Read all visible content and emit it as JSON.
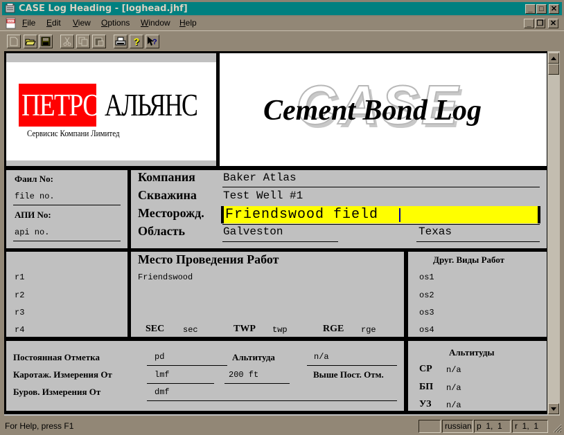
{
  "window": {
    "title": "CASE Log Heading - [loghead.jhf]",
    "controls": {
      "minimize": "_",
      "maximize": "□",
      "close": "✕",
      "restore": "❐"
    }
  },
  "menu": {
    "items": [
      {
        "label": "File",
        "accel": "F"
      },
      {
        "label": "Edit",
        "accel": "E"
      },
      {
        "label": "View",
        "accel": "V"
      },
      {
        "label": "Options",
        "accel": "O"
      },
      {
        "label": "Window",
        "accel": "W"
      },
      {
        "label": "Help",
        "accel": "H"
      }
    ]
  },
  "toolbar": {
    "buttons": [
      "new-file-icon",
      "open-folder-icon",
      "save-icon",
      "cut-icon",
      "copy-icon",
      "paste-icon",
      "print-icon",
      "help-icon",
      "context-help-icon"
    ]
  },
  "header": {
    "logo": {
      "red_part": "ПЕТРО",
      "black_part": "АЛЬЯНС",
      "subtitle": "Сервисис Компани Лимитед"
    },
    "watermark": "CASE",
    "log_title": "Cement Bond Log"
  },
  "well_info": {
    "file_no_label": "Фаил No:",
    "file_no_value": "file no.",
    "api_no_label": "АПИ No:",
    "api_no_value": "api no.",
    "company_label": "Компания",
    "company_value": "Baker Atlas",
    "well_label": "Скважина",
    "well_value": "Test Well #1",
    "field_label": "Месторожд.",
    "field_value": "Friendswood field",
    "field_highlight": "#ffff00",
    "region_label": "Область",
    "county_value": "Galveston",
    "state_value": "Texas"
  },
  "location": {
    "remarks": [
      "r1",
      "r2",
      "r3",
      "r4"
    ],
    "title": "Место Проведения Работ",
    "location_value": "Friendswood",
    "sec_label": "SEC",
    "sec_value": "sec",
    "twp_label": "TWP",
    "twp_value": "twp",
    "rge_label": "RGE",
    "rge_value": "rge",
    "other_services_title": "Друг. Виды Работ",
    "other_services": [
      "os1",
      "os2",
      "os3",
      "os4"
    ]
  },
  "datum": {
    "permanent_datum_label": "Постоянная Отметка",
    "permanent_datum_value": "pd",
    "elevation_label": "Альтитуда",
    "elevation_value": "n/a",
    "log_measured_label": "Каротаж. Измерения От",
    "log_measured_value": "lmf",
    "log_measured_offset": "200 ft",
    "above_pd_label": "Выше Пост. Отм.",
    "drill_measured_label": "Буров. Измерения От",
    "drill_measured_value": "dmf",
    "elevations_title": "Альтитуды",
    "elevations": [
      {
        "label": "СР",
        "value": "n/a"
      },
      {
        "label": "БП",
        "value": "n/a"
      },
      {
        "label": "УЗ",
        "value": "n/a"
      }
    ]
  },
  "status": {
    "help_text": "For Help, press F1",
    "empty_pane": "",
    "language": "russian",
    "page": "p  1,  1",
    "row": "r  1,  1"
  }
}
